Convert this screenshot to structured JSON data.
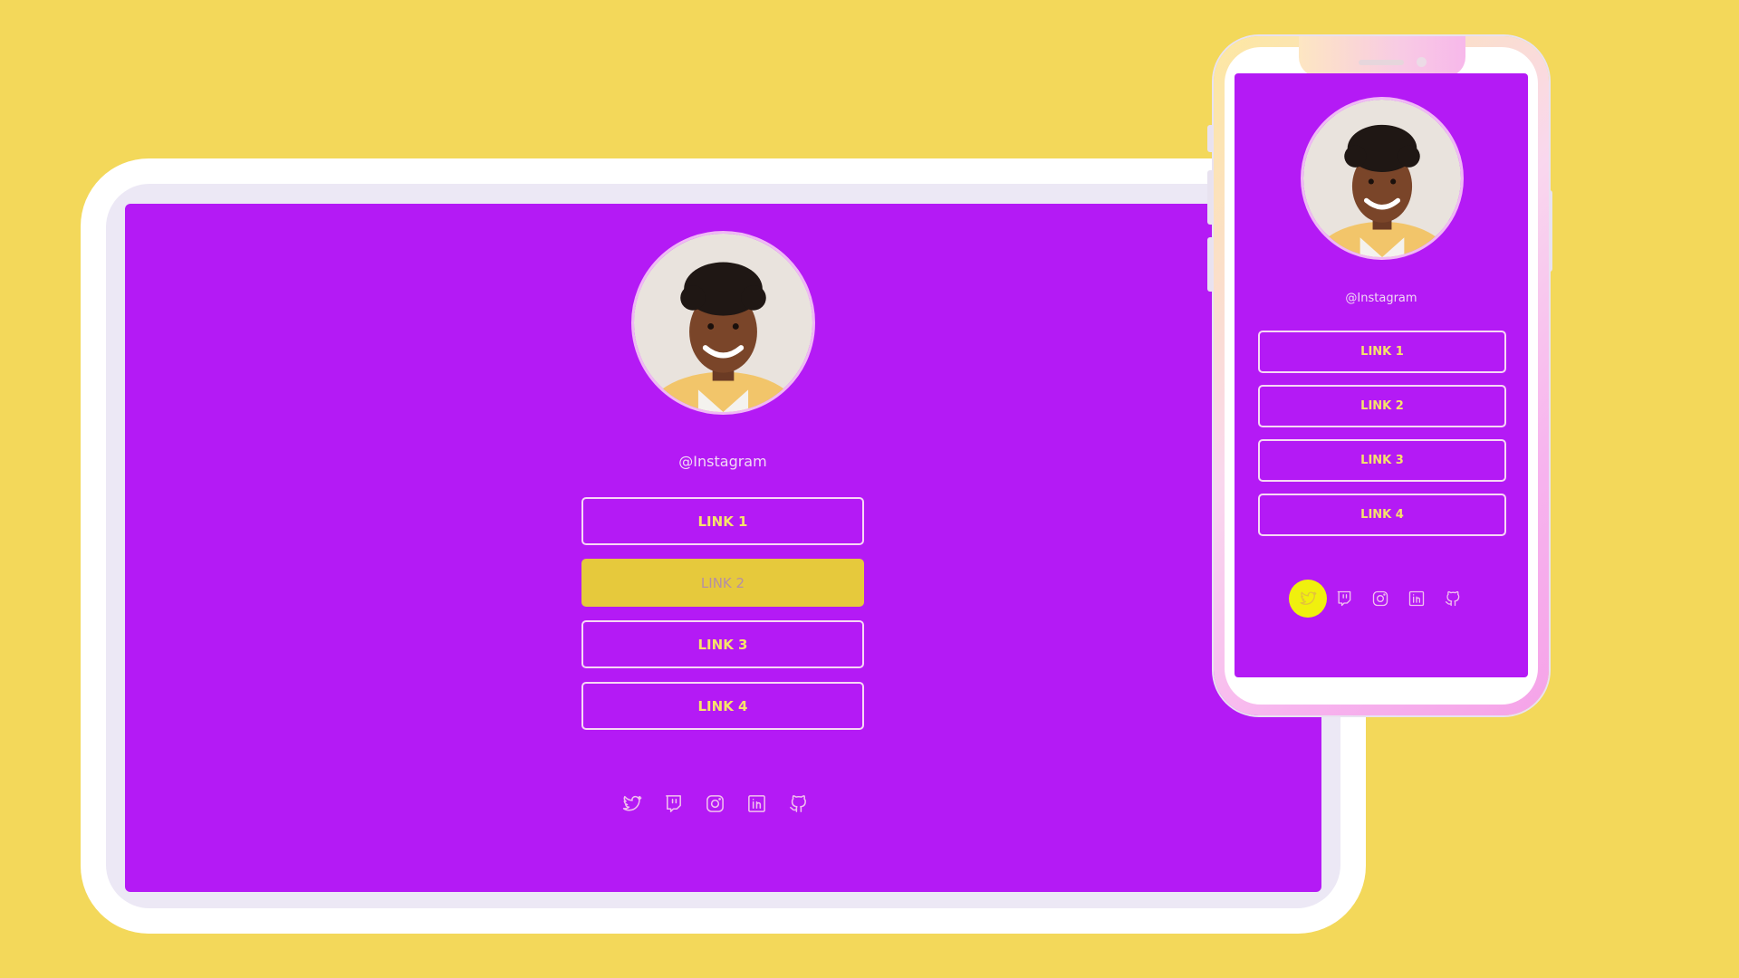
{
  "colors": {
    "background": "#f3d85a",
    "screen": "#b41af5",
    "link_text": "#f6e36a",
    "link_active_bg": "#e6c93c",
    "social_active_bg": "#f0f00e"
  },
  "tablet": {
    "handle": "@Instagram",
    "links": [
      {
        "label": "LINK 1",
        "active": false
      },
      {
        "label": "LINK 2",
        "active": true
      },
      {
        "label": "LINK 3",
        "active": false
      },
      {
        "label": "LINK 4",
        "active": false
      }
    ],
    "socials": [
      "twitter-icon",
      "twitch-icon",
      "instagram-icon",
      "linkedin-icon",
      "github-icon"
    ]
  },
  "phone": {
    "handle": "@Instagram",
    "links": [
      {
        "label": "LINK 1",
        "active": false
      },
      {
        "label": "LINK 2",
        "active": false
      },
      {
        "label": "LINK 3",
        "active": false
      },
      {
        "label": "LINK 4",
        "active": false
      }
    ],
    "socials": [
      "twitter-icon",
      "twitch-icon",
      "instagram-icon",
      "linkedin-icon",
      "github-icon"
    ],
    "active_social": "twitter-icon"
  }
}
